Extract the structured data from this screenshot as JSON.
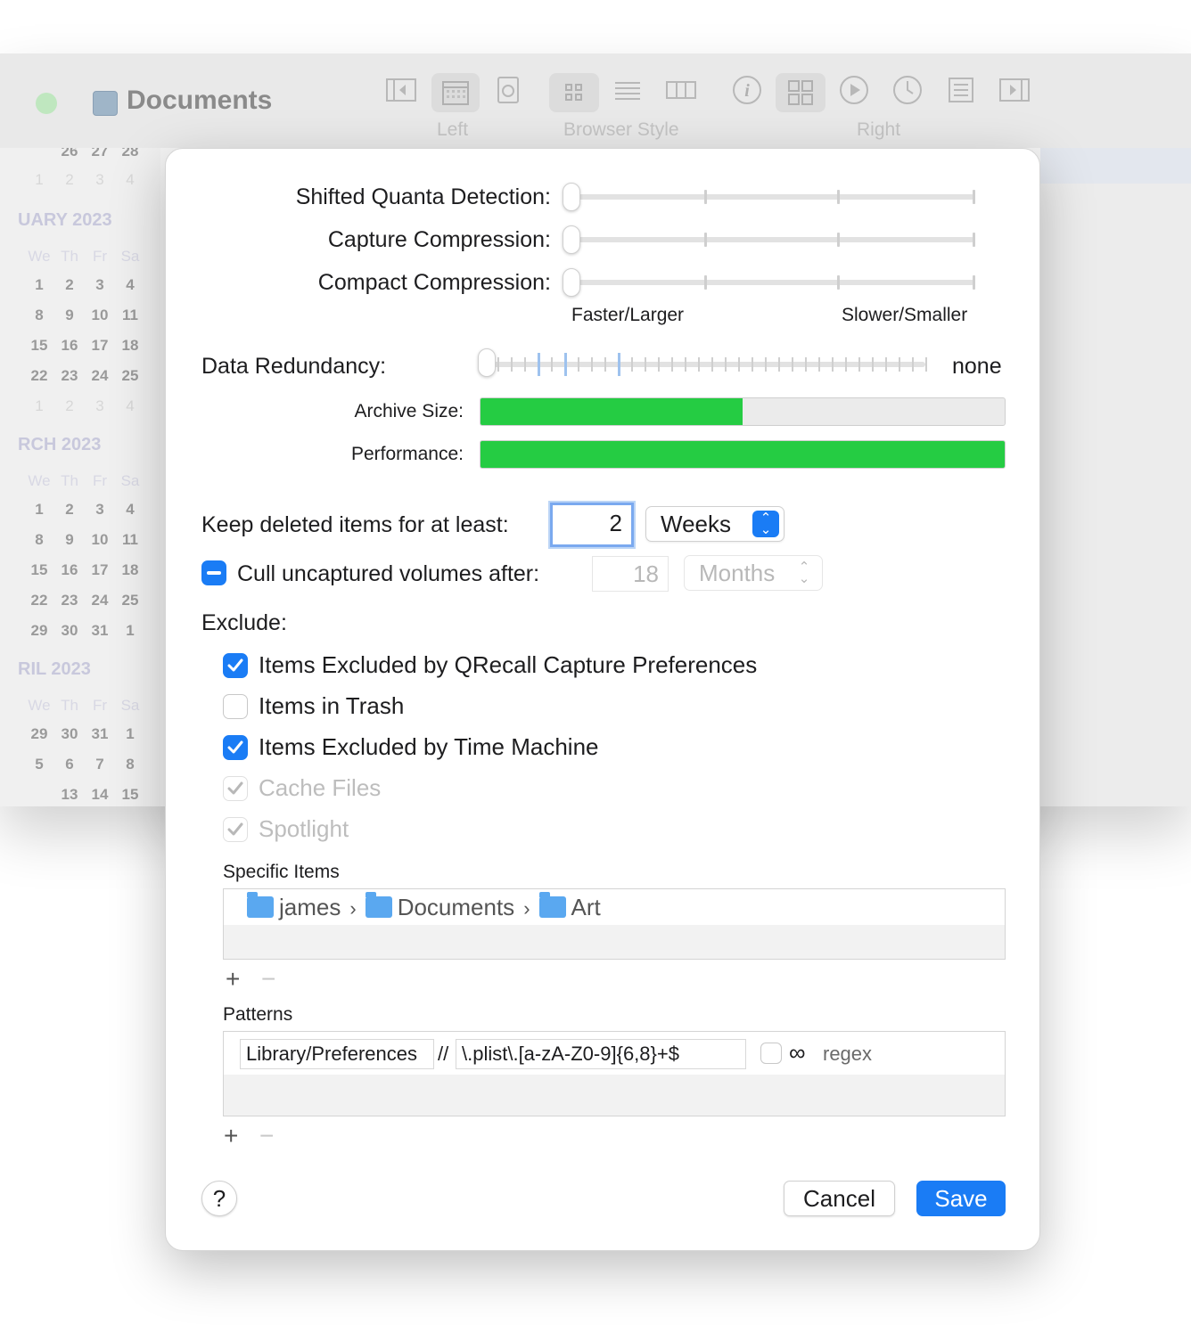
{
  "background_window": {
    "title": "Documents",
    "toolbar_groups": [
      "Left",
      "Browser Style",
      "Right"
    ],
    "calendar": {
      "weekday_headers": [
        "We",
        "Th",
        "Fr",
        "Sa"
      ],
      "months": [
        {
          "label": "UARY 2023"
        },
        {
          "label": "RCH 2023"
        },
        {
          "label": "RIL 2023"
        }
      ],
      "rows": [
        [
          "26",
          "27",
          "28"
        ],
        [
          "1",
          "2",
          "3",
          "4"
        ],
        [
          "1",
          "2",
          "3",
          "4"
        ],
        [
          "8",
          "9",
          "10",
          "11"
        ],
        [
          "15",
          "16",
          "17",
          "18"
        ],
        [
          "22",
          "23",
          "24",
          "25"
        ],
        [
          "1",
          "2",
          "3",
          "4"
        ],
        [
          "1",
          "2",
          "3",
          "4"
        ],
        [
          "8",
          "9",
          "10",
          "11"
        ],
        [
          "15",
          "16",
          "17",
          "18"
        ],
        [
          "22",
          "23",
          "24",
          "25"
        ],
        [
          "29",
          "30",
          "31",
          "1"
        ],
        [
          "29",
          "30",
          "31",
          "1"
        ],
        [
          "5",
          "6",
          "7",
          "8"
        ],
        [
          "13",
          "14",
          "15"
        ]
      ]
    }
  },
  "dialog": {
    "compression": {
      "shifted_label": "Shifted Quanta Detection:",
      "capture_label": "Capture Compression:",
      "compact_label": "Compact Compression:",
      "left_caption": "Faster/Larger",
      "right_caption": "Slower/Smaller",
      "shifted_level": 0,
      "capture_level": 0,
      "compact_level": 0
    },
    "redundancy": {
      "label": "Data Redundancy:",
      "value": "none",
      "level": 0
    },
    "archive_size": {
      "label": "Archive Size:",
      "fill_fraction": 0.5
    },
    "performance": {
      "label": "Performance:",
      "fill_fraction": 1.0
    },
    "keep_deleted": {
      "label": "Keep deleted items for at least:",
      "value": "2",
      "unit": "Weeks"
    },
    "cull": {
      "label": "Cull uncaptured volumes after:",
      "value": "18",
      "unit": "Months",
      "state": "mixed"
    },
    "exclude": {
      "label": "Exclude:",
      "items": [
        {
          "label": "Items Excluded by QRecall Capture Preferences",
          "checked": true,
          "enabled": true
        },
        {
          "label": "Items in Trash",
          "checked": false,
          "enabled": true
        },
        {
          "label": "Items Excluded by Time Machine",
          "checked": true,
          "enabled": true
        },
        {
          "label": "Cache Files",
          "checked": true,
          "enabled": false
        },
        {
          "label": "Spotlight",
          "checked": true,
          "enabled": false
        }
      ]
    },
    "specific_items": {
      "label": "Specific Items",
      "path": [
        "james",
        "Documents",
        "Art"
      ]
    },
    "patterns": {
      "label": "Patterns",
      "rows": [
        {
          "path": "Library/Preferences",
          "separator": "//",
          "pattern": "\\.plist\\.[a-zA-Z0-9]{6,8}+$",
          "infinity": "∞",
          "regex_label": "regex",
          "regex_checked": false
        }
      ]
    },
    "add_symbol": "+",
    "remove_symbol": "−",
    "help_label": "?",
    "cancel_label": "Cancel",
    "save_label": "Save",
    "accent_color": "#1a7cf5",
    "bar_color": "#25cc43"
  }
}
